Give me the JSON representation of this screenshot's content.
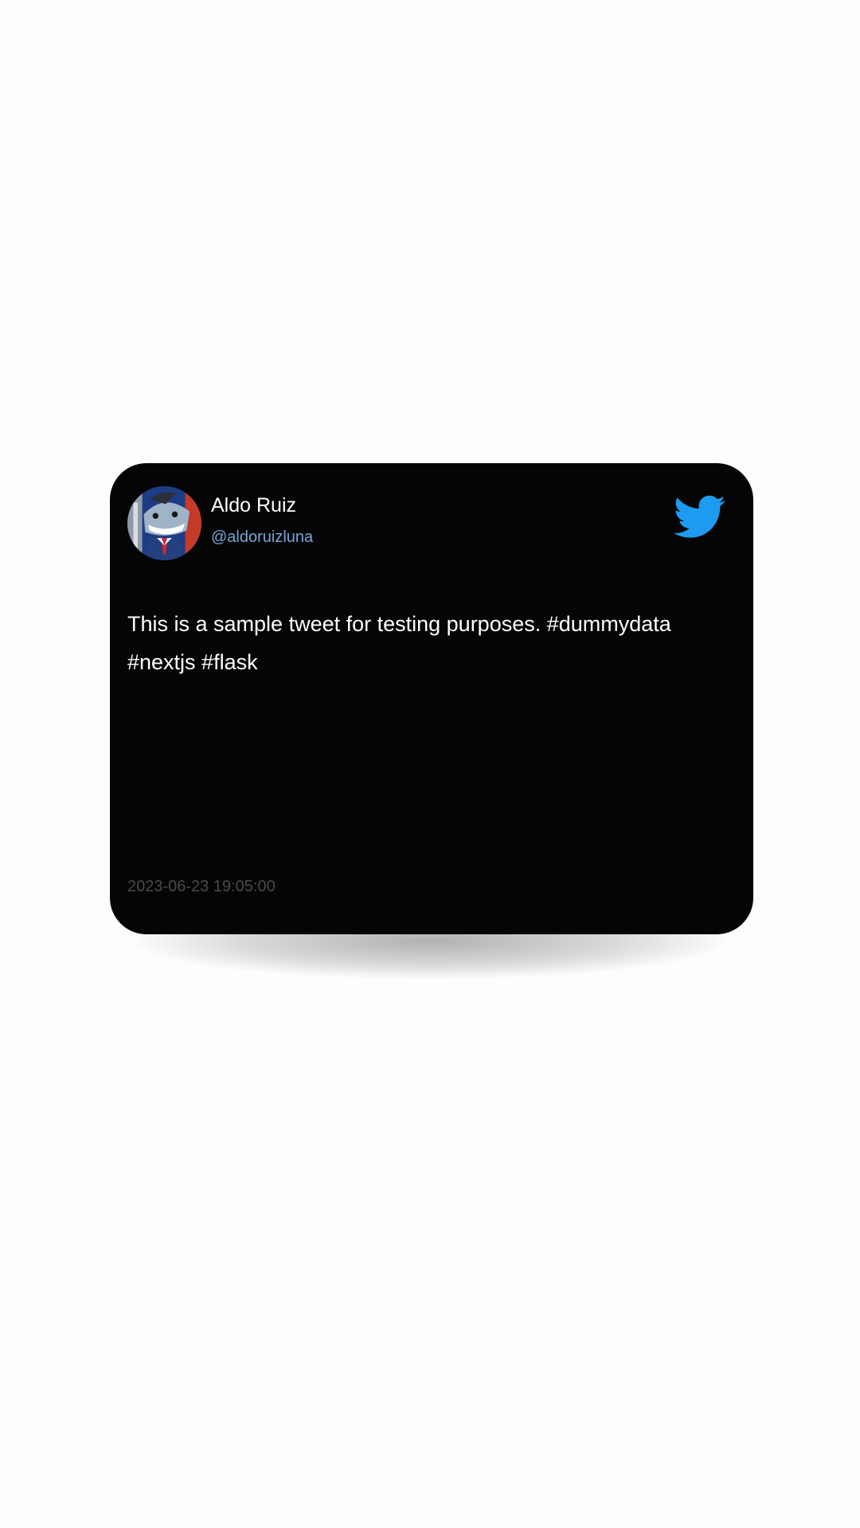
{
  "tweet": {
    "author_name": "Aldo Ruiz",
    "author_handle": "@aldoruizluna",
    "text": "This is a sample tweet for testing purposes. #dummydata #nextjs #flask",
    "timestamp": "2023-06-23 19:05:00",
    "avatar_icon": "shark-cartoon-avatar",
    "logo_icon": "twitter-bird-icon"
  },
  "colors": {
    "card_background": "#050505",
    "page_background": "#fdfdfd",
    "name_text": "#ffffff",
    "handle_text": "#74a6d8",
    "timestamp_text": "#4a4a4a",
    "twitter_blue": "#1d9bf0"
  }
}
